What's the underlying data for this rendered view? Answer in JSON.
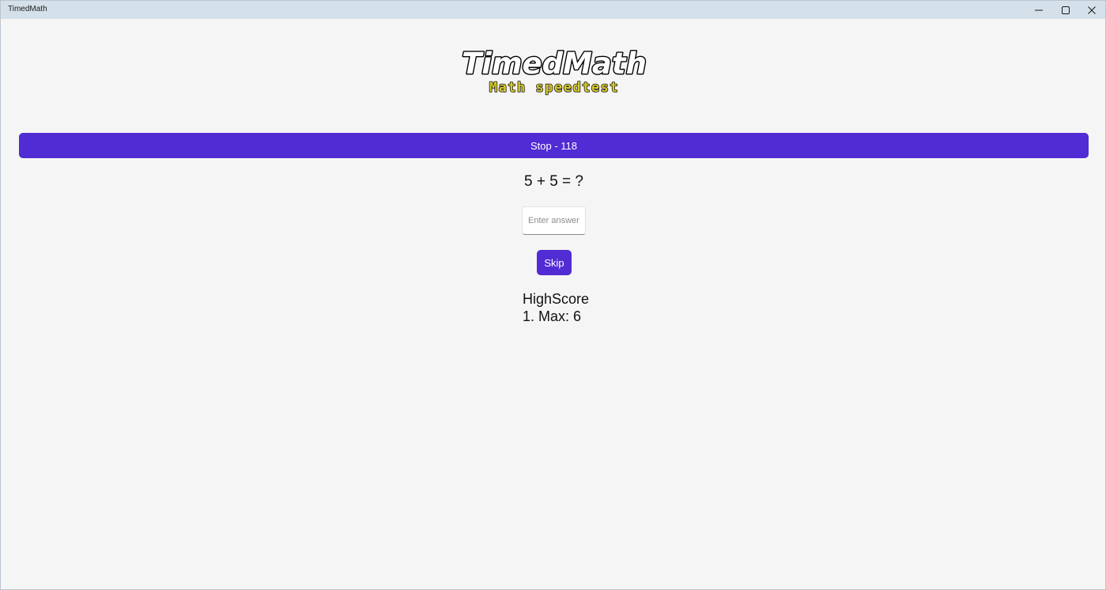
{
  "window": {
    "title": "TimedMath"
  },
  "logo": {
    "title": "TimedMath",
    "subtitle": "Math speedtest"
  },
  "timer": {
    "label": "Stop - 118"
  },
  "quiz": {
    "question": "5 + 5 = ?",
    "answer_value": "",
    "answer_placeholder": "Enter answer",
    "skip_label": "Skip"
  },
  "highscore": {
    "heading": "HighScore",
    "entries": [
      "1. Max: 6"
    ]
  },
  "colors": {
    "accent": "#512bd4",
    "titlebar": "#d5e1ea",
    "background": "#f5f5f5",
    "logo_subtitle": "#d8cb2a"
  },
  "icons": {
    "minimize": "minimize-icon",
    "maximize": "maximize-icon",
    "close": "close-icon"
  }
}
